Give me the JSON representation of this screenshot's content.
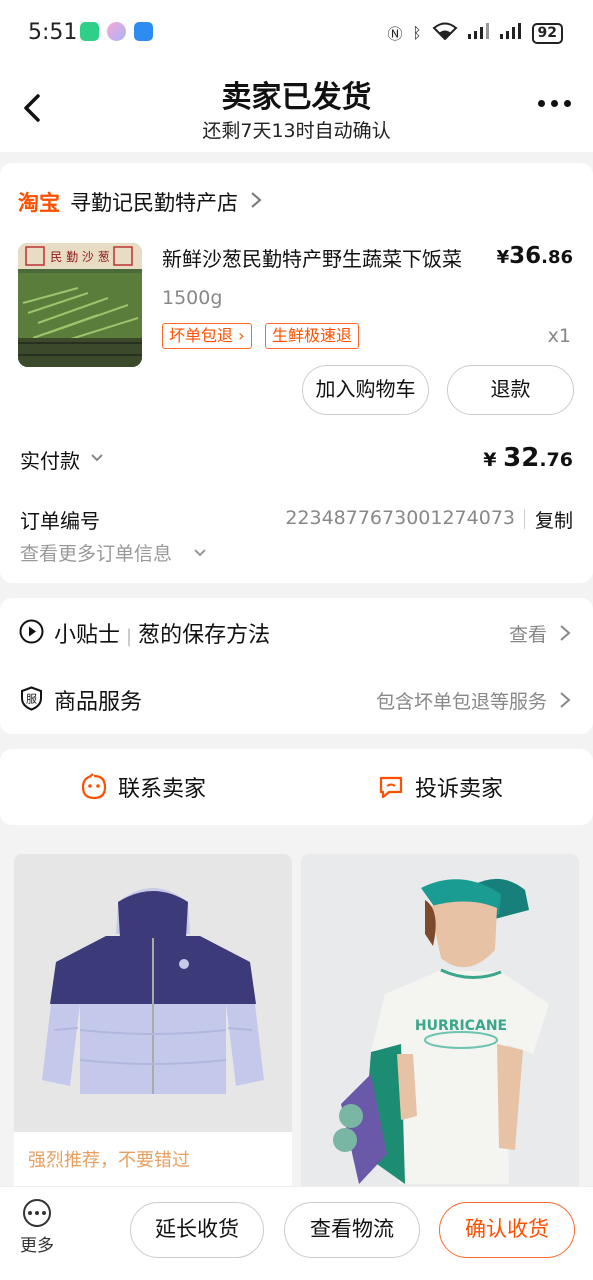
{
  "status_bar": {
    "time": "5:51",
    "signal_label": "5G",
    "battery": "92"
  },
  "header": {
    "title": "卖家已发货",
    "subtitle": "还剩7天13时自动确认"
  },
  "shop": {
    "platform": "淘宝",
    "name": "寻勤记民勤特产店"
  },
  "product": {
    "thumb_text": "民 勤 沙 葱",
    "title": "新鲜沙葱民勤特产野生蔬菜下饭菜",
    "price_symbol": "¥",
    "price_int": "36",
    "price_dec": ".86",
    "spec": "1500g",
    "tags": [
      "坏单包退 ›",
      "生鲜极速退"
    ],
    "quantity": "x1",
    "add_cart_label": "加入购物车",
    "refund_label": "退款"
  },
  "payment": {
    "label": "实付款",
    "symbol": "¥",
    "amount_int": "32",
    "amount_dec": ".76"
  },
  "order": {
    "label": "订单编号",
    "number": "2234877673001274073",
    "copy_label": "复制",
    "more_info_label": "查看更多订单信息"
  },
  "tips": {
    "label": "小贴士",
    "title": "葱的保存方法",
    "action": "查看"
  },
  "service": {
    "label": "商品服务",
    "icon_text": "服",
    "detail": "包含坏单包退等服务"
  },
  "contact": {
    "seller_label": "联系卖家",
    "complain_label": "投诉卖家"
  },
  "recommendations": [
    {
      "caption": "强烈推荐，不要错过"
    },
    {
      "shirt_text": "HURRICANE"
    }
  ],
  "bottom_bar": {
    "more_label": "更多",
    "extend_label": "延长收货",
    "logistics_label": "查看物流",
    "confirm_label": "确认收货"
  },
  "colors": {
    "accent": "#ff5000",
    "caption": "#e8a060"
  }
}
